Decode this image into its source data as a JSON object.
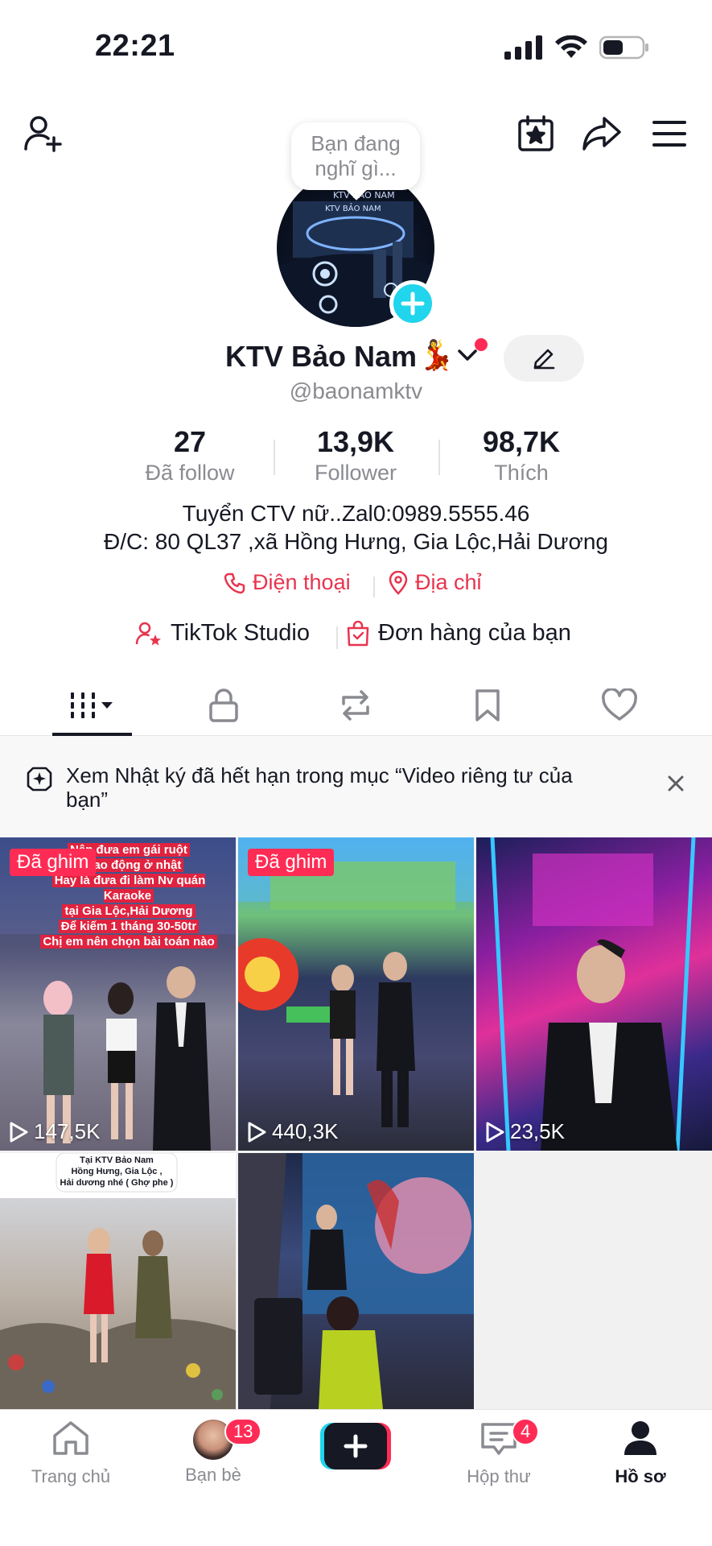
{
  "status": {
    "time": "22:21"
  },
  "profile": {
    "thought_bubble": "Bạn đang nghĩ gì...",
    "display_name": "KTV Bảo Nam",
    "name_emoji": "💃",
    "username": "@baonamktv",
    "avatar_text_1": "KTV BẢO NAM",
    "avatar_text_2": "KTV BẢO NAM"
  },
  "stats": [
    {
      "value": "27",
      "label": "Đã follow"
    },
    {
      "value": "13,9K",
      "label": "Follower"
    },
    {
      "value": "98,7K",
      "label": "Thích"
    }
  ],
  "bio": {
    "line1": "Tuyển CTV nữ..Zal0:0989.5555.46",
    "line2": "Đ/C: 80 QL37 ,xã Hồng Hưng, Gia Lộc,Hải Dương"
  },
  "links": {
    "phone": "Điện thoại",
    "address": "Địa chỉ"
  },
  "tools": {
    "studio": "TikTok Studio",
    "orders": "Đơn hàng của bạn"
  },
  "notice": {
    "text": "Xem Nhật ký đã hết hạn trong mục “Video riêng tư của bạn”"
  },
  "videos": [
    {
      "pinned": "Đã ghim",
      "views": "147,5K",
      "overlay": [
        "Nên đưa em gái ruột",
        "đi lao động ở nhật",
        "Hay là đưa đi làm Nv quán Karaoke",
        "tại Gia Lộc,Hải Dương",
        "Để kiếm 1 tháng 30-50tr",
        "Chị em nên chọn bài toán nào"
      ]
    },
    {
      "pinned": "Đã ghim",
      "views": "440,3K"
    },
    {
      "views": "23,5K"
    },
    {
      "overlay_top": [
        "Tại KTV Bảo Nam",
        "Hồng Hưng, Gia Lộc ,",
        "Hải dương nhé ( Ghợ phe )"
      ]
    },
    {}
  ],
  "nav": {
    "home": "Trang chủ",
    "friends": "Bạn bè",
    "friends_badge": "13",
    "inbox": "Hộp thư",
    "inbox_badge": "4",
    "profile": "Hồ sơ"
  }
}
